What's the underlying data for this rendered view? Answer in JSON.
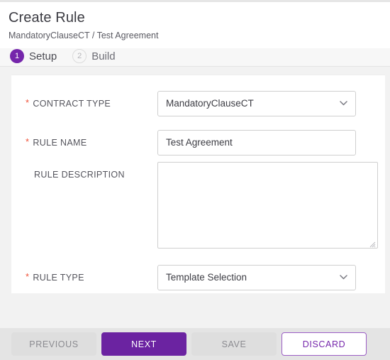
{
  "header": {
    "title": "Create Rule",
    "breadcrumb": "MandatoryClauseCT / Test Agreement"
  },
  "stepper": {
    "steps": [
      {
        "number": "1",
        "label": "Setup",
        "state": "active"
      },
      {
        "number": "2",
        "label": "Build",
        "state": "inactive"
      }
    ]
  },
  "form": {
    "fields": [
      {
        "label": "CONTRACT TYPE",
        "required": true,
        "type": "select",
        "value": "MandatoryClauseCT",
        "icon": "chevron-down-icon"
      },
      {
        "label": "RULE NAME",
        "required": true,
        "type": "text",
        "value": "Test Agreement",
        "placeholder": ""
      },
      {
        "label": "RULE DESCRIPTION",
        "required": false,
        "type": "textarea",
        "value": "",
        "placeholder": ""
      },
      {
        "label": "RULE TYPE",
        "required": true,
        "type": "select",
        "value": "Template Selection",
        "icon": "chevron-down-icon"
      }
    ]
  },
  "footer": {
    "buttons": [
      {
        "label": "PREVIOUS",
        "style": "disabled"
      },
      {
        "label": "NEXT",
        "style": "primary"
      },
      {
        "label": "SAVE",
        "style": "disabled"
      },
      {
        "label": "DISCARD",
        "style": "outline"
      }
    ]
  },
  "colors": {
    "brand_purple": "#6b23a1",
    "step_active": "#7526ab",
    "outline_purple": "#9b5ec4",
    "required_star": "#f0533a",
    "page_background": "#f2f2f2",
    "footer_background": "#e4e4e4",
    "card_background": "#ffffff",
    "input_border": "#cfcfcf"
  }
}
